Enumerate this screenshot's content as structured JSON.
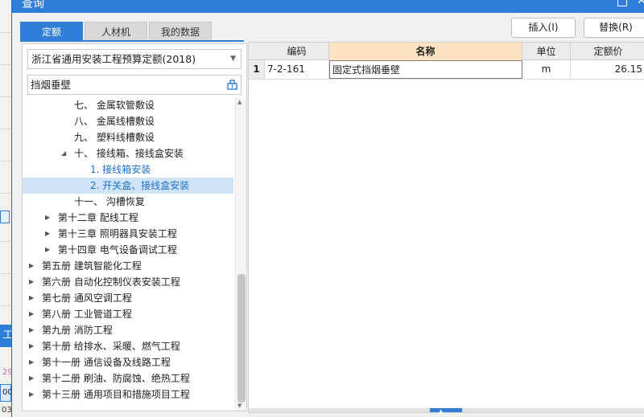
{
  "dialog": {
    "title": "查询"
  },
  "tabs": [
    {
      "label": "定额"
    },
    {
      "label": "人材机"
    },
    {
      "label": "我的数据"
    }
  ],
  "buttons": {
    "insert": "插入(I)",
    "replace": "替换(R)"
  },
  "quota_select": {
    "value": "浙江省通用安装工程预算定额(2018)"
  },
  "search": {
    "value": "挡烟垂壁"
  },
  "tree": [
    {
      "label": "七、 金属软管敷设",
      "arrow": ""
    },
    {
      "label": "八、 金属线槽敷设",
      "arrow": ""
    },
    {
      "label": "九、 塑料线槽敷设",
      "arrow": ""
    },
    {
      "label": "十、 接线箱、接线盒安装",
      "arrow": "◢"
    },
    {
      "label": "1. 接线箱安装",
      "arrow": ""
    },
    {
      "label": "2. 开关盒、接线盒安装",
      "arrow": ""
    },
    {
      "label": "十一、 沟槽恢复",
      "arrow": ""
    },
    {
      "label": "第十二章 配线工程",
      "arrow": "▶"
    },
    {
      "label": "第十三章 照明器具安装工程",
      "arrow": "▶"
    },
    {
      "label": "第十四章 电气设备调试工程",
      "arrow": "▶"
    },
    {
      "label": "第五册 建筑智能化工程",
      "arrow": "▶"
    },
    {
      "label": "第六册 自动化控制仪表安装工程",
      "arrow": "▶"
    },
    {
      "label": "第七册 通风空调工程",
      "arrow": "▶"
    },
    {
      "label": "第八册 工业管道工程",
      "arrow": "▶"
    },
    {
      "label": "第九册 消防工程",
      "arrow": "▶"
    },
    {
      "label": "第十册 给排水、采暖、燃气工程",
      "arrow": "▶"
    },
    {
      "label": "第十一册 通信设备及线路工程",
      "arrow": "▶"
    },
    {
      "label": "第十二册 刷油、防腐蚀、绝热工程",
      "arrow": "▶"
    },
    {
      "label": "第十三册 通用项目和措施项目工程",
      "arrow": "▶"
    }
  ],
  "grid": {
    "columns": {
      "code": "编码",
      "name": "名称",
      "unit": "单位",
      "price": "定额价"
    },
    "rows": [
      {
        "index": "1",
        "code": "7-2-161",
        "name": "固定式挡烟垂壁",
        "unit": "m",
        "price": "26.15"
      }
    ]
  },
  "background": {
    "tab_label": "工",
    "row_a": "29",
    "row_b": "00",
    "row_c": "03"
  },
  "colors": {
    "accent": "#2f7fd8",
    "selected_row": "#cfe5f7",
    "name_header": "#fbe3c2"
  }
}
